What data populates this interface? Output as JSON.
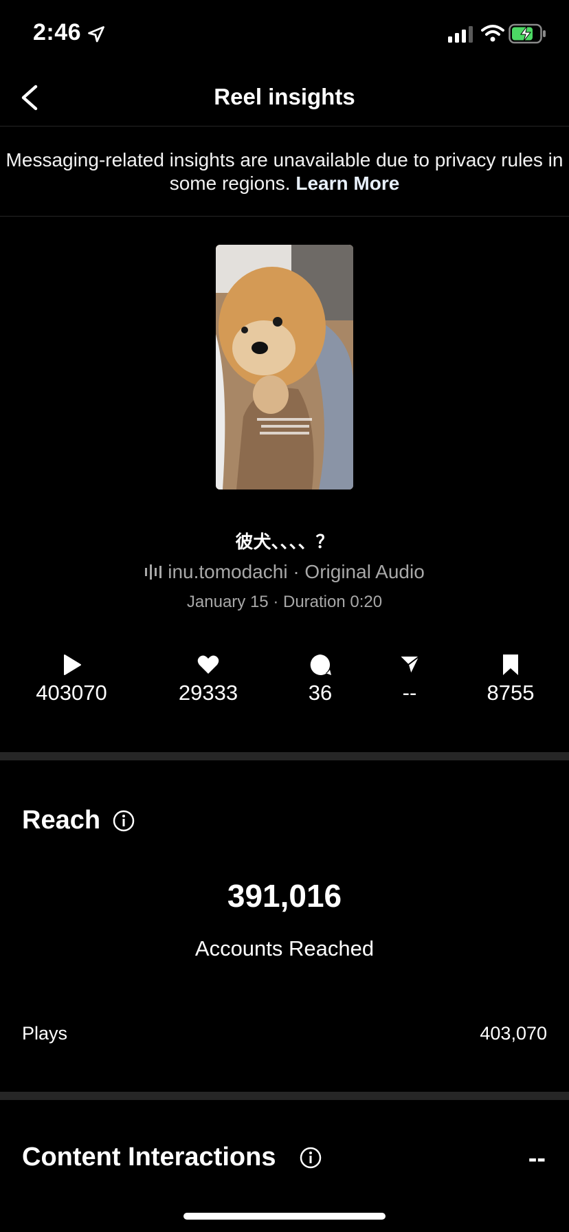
{
  "status_bar": {
    "time": "2:46"
  },
  "nav": {
    "title": "Reel insights"
  },
  "notice": {
    "text": "Messaging-related insights are unavailable due to privacy rules in some regions.",
    "link": "Learn More"
  },
  "reel": {
    "title": "彼犬、、、、？",
    "audio": "inu.tomodachi · Original Audio",
    "meta": "January 15 · Duration 0:20"
  },
  "stats": {
    "plays": "403070",
    "likes": "29333",
    "comments": "36",
    "shares": "--",
    "saves": "8755"
  },
  "reach": {
    "title": "Reach",
    "value": "391,016",
    "label": "Accounts Reached",
    "plays_label": "Plays",
    "plays_value": "403,070"
  },
  "content_interactions": {
    "title": "Content Interactions",
    "value": "--"
  }
}
